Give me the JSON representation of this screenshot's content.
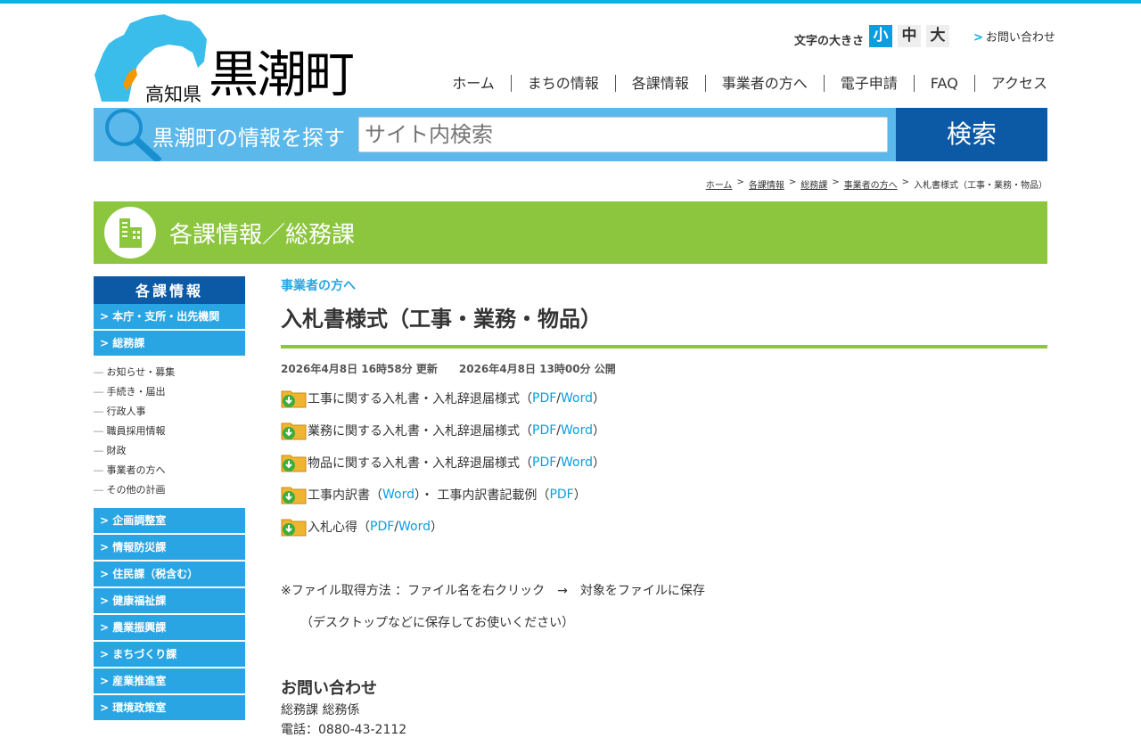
{
  "header": {
    "pref": "高知県",
    "town": "黒潮町",
    "font_size_label": "文字の大きさ",
    "font_sizes": [
      "小",
      "中",
      "大"
    ],
    "contact_link": "お問い合わせ",
    "nav": [
      "ホーム",
      "まちの情報",
      "各課情報",
      "事業者の方へ",
      "電子申請",
      "FAQ",
      "アクセス"
    ]
  },
  "search": {
    "label": "黒潮町の情報を探す",
    "placeholder": "サイト内検索",
    "button": "検索"
  },
  "breadcrumb": [
    "ホーム",
    "各課情報",
    "総務課",
    "事業者の方へ",
    "入札書様式（工事・業務・物品）"
  ],
  "banner": {
    "title": "各課情報／総務課"
  },
  "sidebar": {
    "heading": "各課情報",
    "top_items": [
      "本庁・支所・出先機関",
      "総務課"
    ],
    "sub_items": [
      "お知らせ・募集",
      "手続き・届出",
      "行政人事",
      "職員採用情報",
      "財政",
      "事業者の方へ",
      "その他の計画"
    ],
    "bottom_items": [
      "企画調整室",
      "情報防災課",
      "住民課（税含む）",
      "健康福祉課",
      "農業振興課",
      "まちづくり課",
      "産業推進室",
      "環境政策室"
    ]
  },
  "main": {
    "category": "事業者の方へ",
    "title": "入札書様式（工事・業務・物品）",
    "updated": "2026年4月8日 16時58分 更新",
    "published": "2026年4月8日 13時00分 公開",
    "downloads": [
      {
        "text": "工事に関する入札書・入札辞退届様式（",
        "l1": "PDF",
        "sep": " / ",
        "l2": "Word",
        "end": "）"
      },
      {
        "text": "業務に関する入札書・入札辞退届様式（",
        "l1": "PDF",
        "sep": " / ",
        "l2": "Word",
        "end": "）"
      },
      {
        "text": "物品に関する入札書・入札辞退届様式（",
        "l1": "PDF",
        "sep": " / ",
        "l2": "Word",
        "end": "）"
      },
      {
        "text": "工事内訳書（",
        "l1": "Word",
        "sep": "）・ 工事内訳書記載例（",
        "l2": "PDF",
        "end": "）"
      },
      {
        "text": "入札心得（",
        "l1": "PDF",
        "sep": " / ",
        "l2": "Word",
        "end": "）"
      }
    ],
    "note": "※ファイル取得方法 ：ファイル名を右クリック　→　対象をファイルに保存",
    "note2": "（デスクトップなどに保存してお使いください）",
    "contact_heading": "お問い合わせ",
    "contact_dept": "総務課 総務係",
    "contact_phone": "電話：0880-43-2112"
  }
}
